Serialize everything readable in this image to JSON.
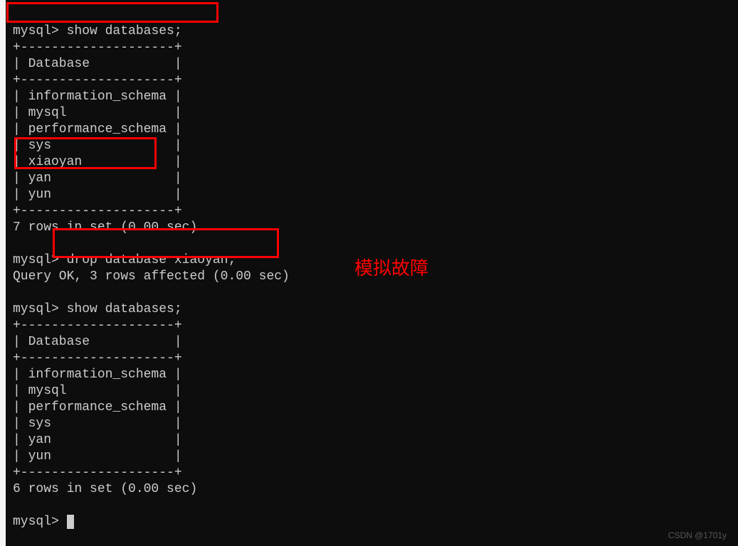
{
  "terminal": {
    "prompt": "mysql>",
    "commands": {
      "show1": "show databases;",
      "drop": "drop database xiaoyan;",
      "show2": "show databases;"
    },
    "table1": {
      "border_top": "+--------------------+",
      "header": "| Database           |",
      "border_mid": "+--------------------+",
      "rows": [
        "| information_schema |",
        "| mysql              |",
        "| performance_schema |",
        "| sys                |",
        "| xiaoyan            |",
        "| yan                |",
        "| yun                |"
      ],
      "border_bot": "+--------------------+",
      "summary": "7 rows in set (0.00 sec)"
    },
    "drop_result": "Query OK, 3 rows affected (0.00 sec)",
    "table2": {
      "border_top": "+--------------------+",
      "header": "| Database           |",
      "border_mid": "+--------------------+",
      "rows": [
        "| information_schema |",
        "| mysql              |",
        "| performance_schema |",
        "| sys                |",
        "| yan                |",
        "| yun                |"
      ],
      "border_bot": "+--------------------+",
      "summary": "6 rows in set (0.00 sec)"
    }
  },
  "annotation": {
    "label1": "模拟故障"
  },
  "watermark": "CSDN @1701y"
}
